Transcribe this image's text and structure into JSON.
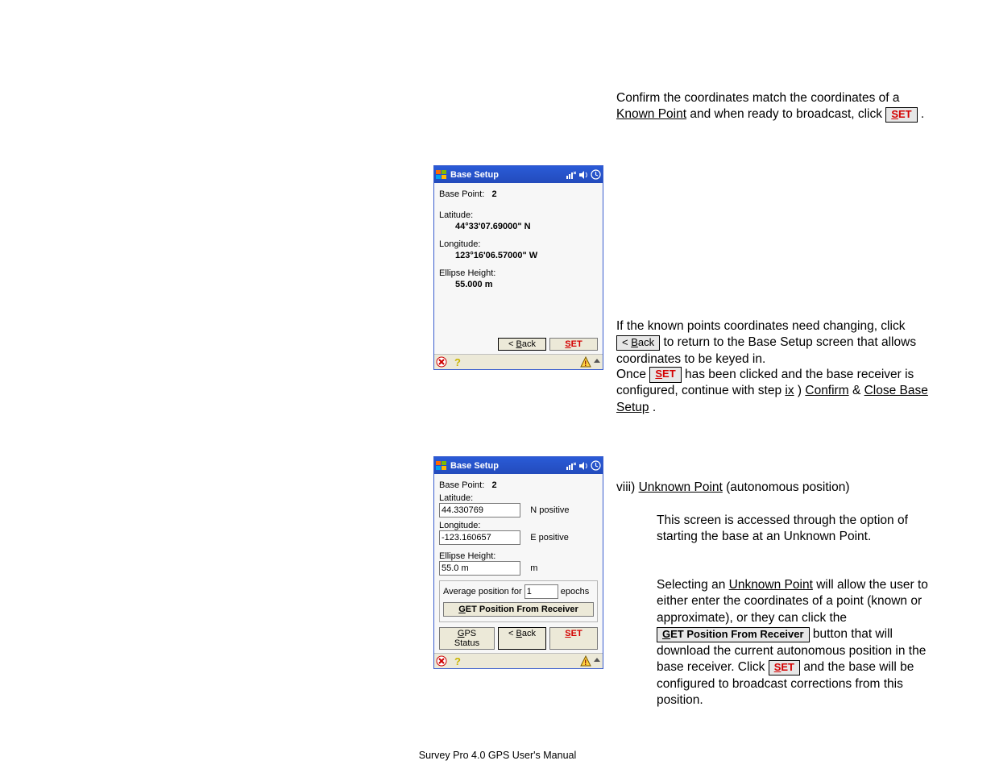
{
  "pda1": {
    "title": "Base Setup",
    "base_point_label": "Base Point:",
    "base_point_value": "2",
    "latitude_label": "Latitude:",
    "latitude_value": "44°33'07.69000\" N",
    "longitude_label": "Longitude:",
    "longitude_value": "123°16'06.57000\" W",
    "height_label": "Ellipse Height:",
    "height_value": "55.000 m",
    "back_label": "< Back",
    "set_label": "SET"
  },
  "pda2": {
    "title": "Base Setup",
    "base_point_label": "Base Point:",
    "base_point_value": "2",
    "latitude_label": "Latitude:",
    "latitude_value": "44.330769",
    "latitude_hint": "N positive",
    "longitude_label": "Longitude:",
    "longitude_value": "-123.160657",
    "longitude_hint": "E positive",
    "height_label": "Ellipse Height:",
    "height_value": "55.0 m",
    "height_unit": "m",
    "avg_prefix": "Average position for",
    "avg_value": "1",
    "avg_suffix": "epochs",
    "get_pos_label_pre": "G",
    "get_pos_label_rest": "ET Position From Receiver",
    "gps_status_label": "GPS Status",
    "back_label": "< Back",
    "set_label": "SET"
  },
  "text": {
    "block1_l1a": "Confirm the coordinates match the coordinates of a",
    "block1_l1b": "Known Point",
    "block1_l1c": " and when ready to broadcast, click ",
    "block1_l2b": ".",
    "block2_l1a": "If the known points coordinates need changing, click",
    "block2_l2b": " to return to the Base Setup screen that allows coordinates to be keyed in.",
    "block3_l1a": "Once ",
    "block3_l1c": " has been clicked and the base receiver is configured, continue with step ",
    "block3_u1": "ix",
    "block3_l1d": ") ",
    "block3_u2": "Confirm",
    "block3_l1e": " & ",
    "block3_u3": "Close Base Setup",
    "block3_l1f": ".",
    "block3_l2a": "viii)    ",
    "block3_u4": "Unknown Point",
    "block3_l2b": " (autonomous position)",
    "block3_l3": "This screen is accessed through the option of starting the base at an Unknown Point.",
    "block3_l4a": "Selecting an ",
    "block3_u5": "Unknown Point",
    "block3_l4b": " will allow the user to either enter the coordinates of a point (known or approximate), or they can click the ",
    "block3_btn_get": "GET Position From Receiver",
    "block3_l4c": " button that will download the current autonomous position in the base receiver.  Click ",
    "block3_l4d": " and the base will be configured to broadcast corrections from this position."
  },
  "footer": "Survey Pro 4.0 GPS User's Manual"
}
